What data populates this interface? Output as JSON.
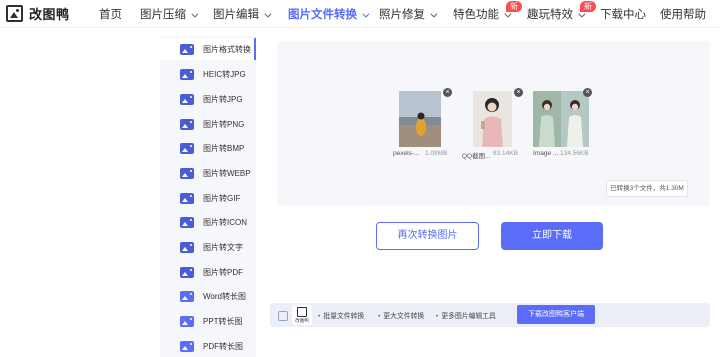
{
  "app": {
    "logo_text": "改图鸭"
  },
  "nav": {
    "items": [
      {
        "label": "首页"
      },
      {
        "label": "图片压缩"
      },
      {
        "label": "图片编辑"
      },
      {
        "label": "图片文件转换"
      },
      {
        "label": "照片修复"
      },
      {
        "label": "特色功能",
        "badge": "新"
      },
      {
        "label": "趣玩特效",
        "badge": "新"
      },
      {
        "label": "下载中心"
      },
      {
        "label": "使用帮助"
      }
    ]
  },
  "sidebar": {
    "items": [
      {
        "label": "图片格式转换"
      },
      {
        "label": "HEIC转JPG"
      },
      {
        "label": "图片转JPG"
      },
      {
        "label": "图片转PNG"
      },
      {
        "label": "图片转BMP"
      },
      {
        "label": "图片转WEBP"
      },
      {
        "label": "图片转GIF"
      },
      {
        "label": "图片转ICON"
      },
      {
        "label": "图片转文字"
      },
      {
        "label": "图片转PDF"
      },
      {
        "label": "Word转长图"
      },
      {
        "label": "PPT转长图"
      },
      {
        "label": "PDF转长图"
      }
    ]
  },
  "files": [
    {
      "name": "pexels-...",
      "size": "1.09MB"
    },
    {
      "name": "QQ截图...",
      "size": "83.14KB"
    },
    {
      "name": "Image ...",
      "size": "134.56KB"
    }
  ],
  "summary": "已转换3个文件，共1.30M",
  "actions": {
    "convert_again": "再次转换图片",
    "download_now": "立即下载"
  },
  "promo": {
    "logo_caption": "改图鸭",
    "features": [
      "批量文件转换",
      "更大文件转换",
      "更多图片编辑工具"
    ],
    "button": "下载改图鸭客户端"
  }
}
